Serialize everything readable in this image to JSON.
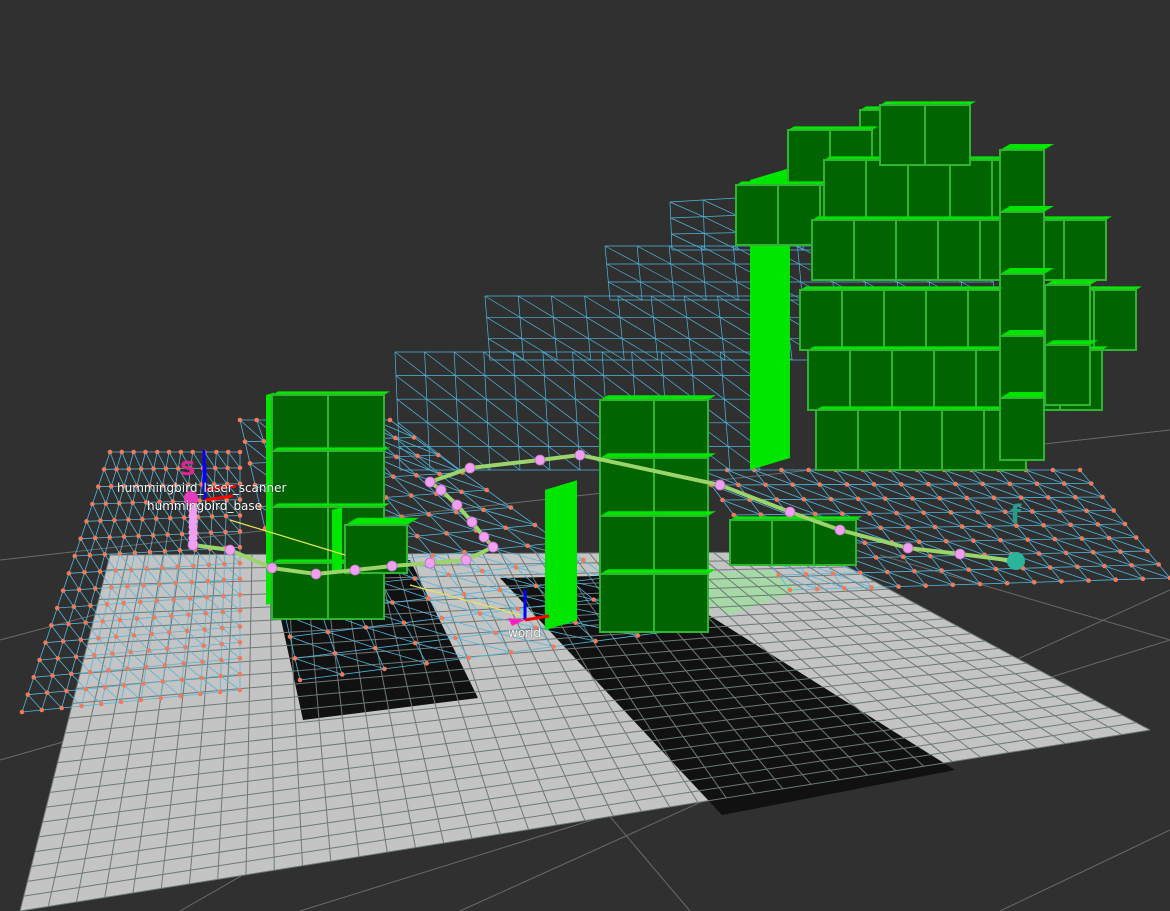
{
  "viewport": {
    "name": "3D view",
    "background_color": "#303030",
    "frames": [
      {
        "label": "hummingbird_laser_scanner"
      },
      {
        "label": "hummingbird_base"
      },
      {
        "label": "world"
      }
    ],
    "markers": {
      "start_label": "s",
      "finish_label": "f"
    },
    "colors": {
      "occupied_voxel": "#00e600",
      "voxel_dark": "#006400",
      "wireframe": "#4fb7e0",
      "wire_node": "#f07a5a",
      "path": "#9ad46a",
      "waypoint": "#f0a0f0",
      "floor_free": "#c4c4c4",
      "floor_occupied": "#111111"
    }
  }
}
